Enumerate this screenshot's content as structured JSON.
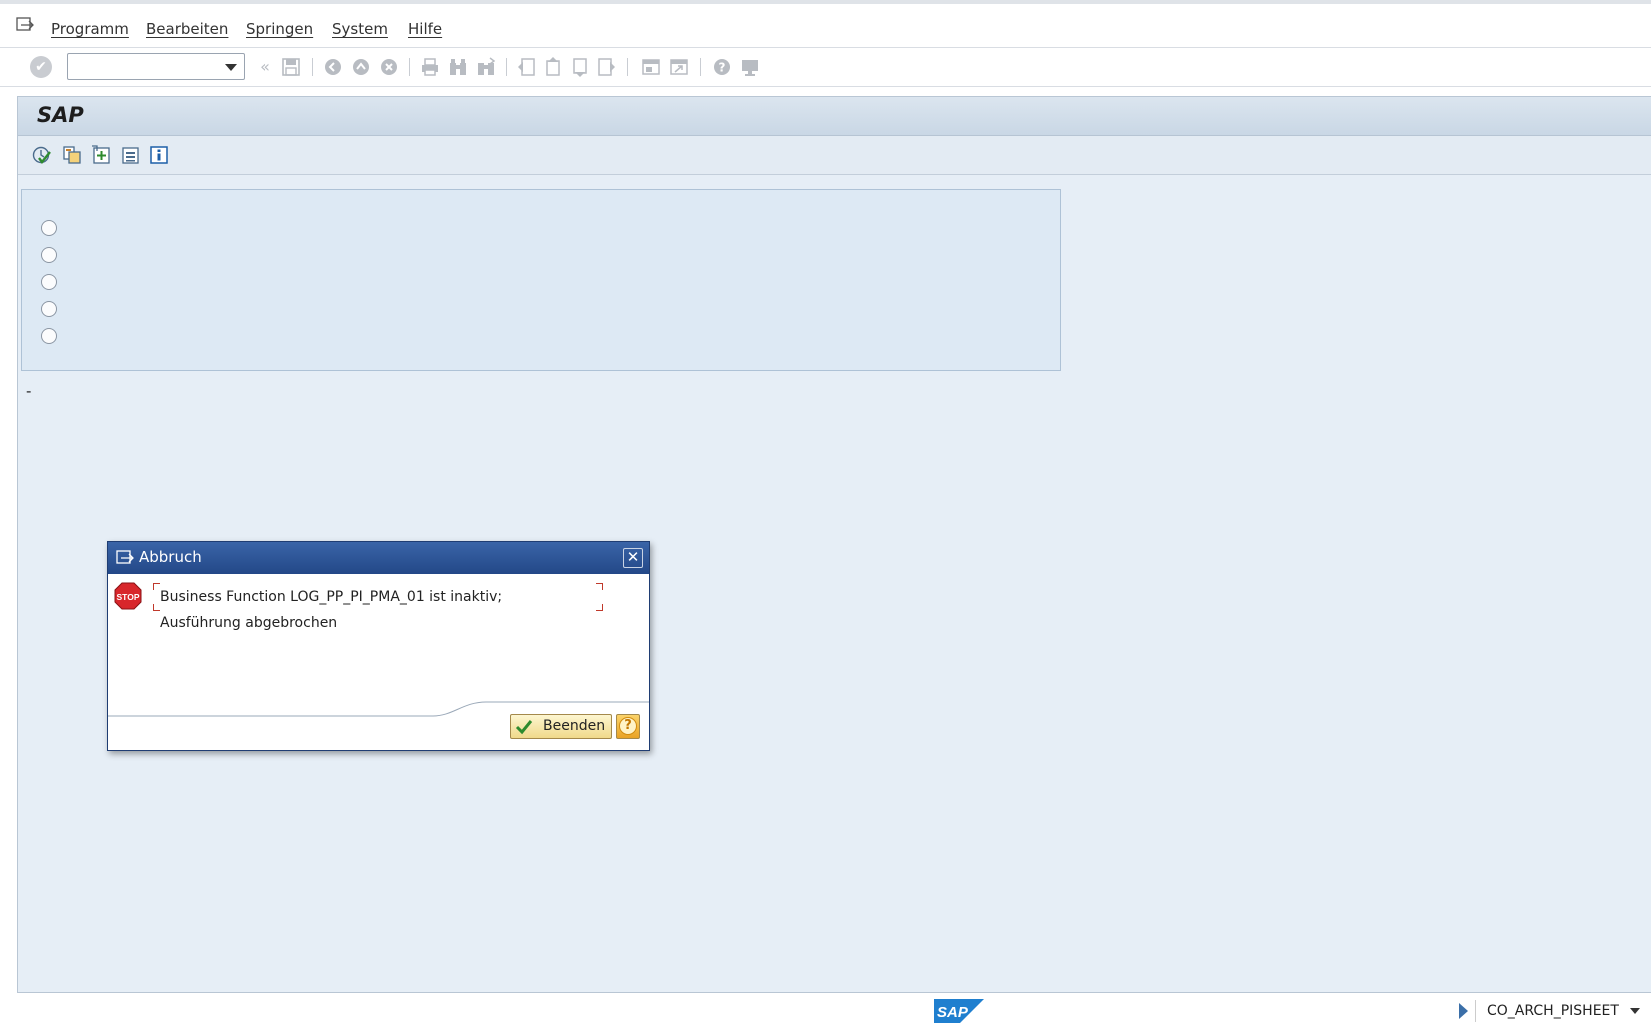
{
  "menu": {
    "items": [
      "Programm",
      "Bearbeiten",
      "Springen",
      "System",
      "Hilfe"
    ]
  },
  "toolbar": {
    "command_value": "",
    "icons": [
      "enter-icon",
      "back-double-icon",
      "save-icon",
      "back-icon",
      "exit-icon",
      "cancel-icon",
      "print-icon",
      "find-icon",
      "find-next-icon",
      "first-page-icon",
      "previous-page-icon",
      "next-page-icon",
      "last-page-icon",
      "new-session-icon",
      "shortcut-icon",
      "help-icon",
      "layout-menu-icon"
    ]
  },
  "screen": {
    "title": "SAP",
    "app_toolbar_icons": [
      "execute-icon",
      "copy-variant-icon",
      "create-icon",
      "select-icon",
      "info-icon"
    ],
    "radio_count": 5,
    "dash_text": "-"
  },
  "dialog": {
    "title": "Abbruch",
    "message_line1": "Business Function LOG_PP_PI_PMA_01 ist inaktiv;",
    "message_line2": "Ausführung abgebrochen",
    "button_label": "Beenden",
    "help_label": "?"
  },
  "status": {
    "transaction": "CO_ARCH_PISHEET",
    "logo": "SAP"
  },
  "colors": {
    "dialog_title": "#2c5597",
    "main_bg": "#e6eef6",
    "button_bg": "#f5e6a8"
  }
}
